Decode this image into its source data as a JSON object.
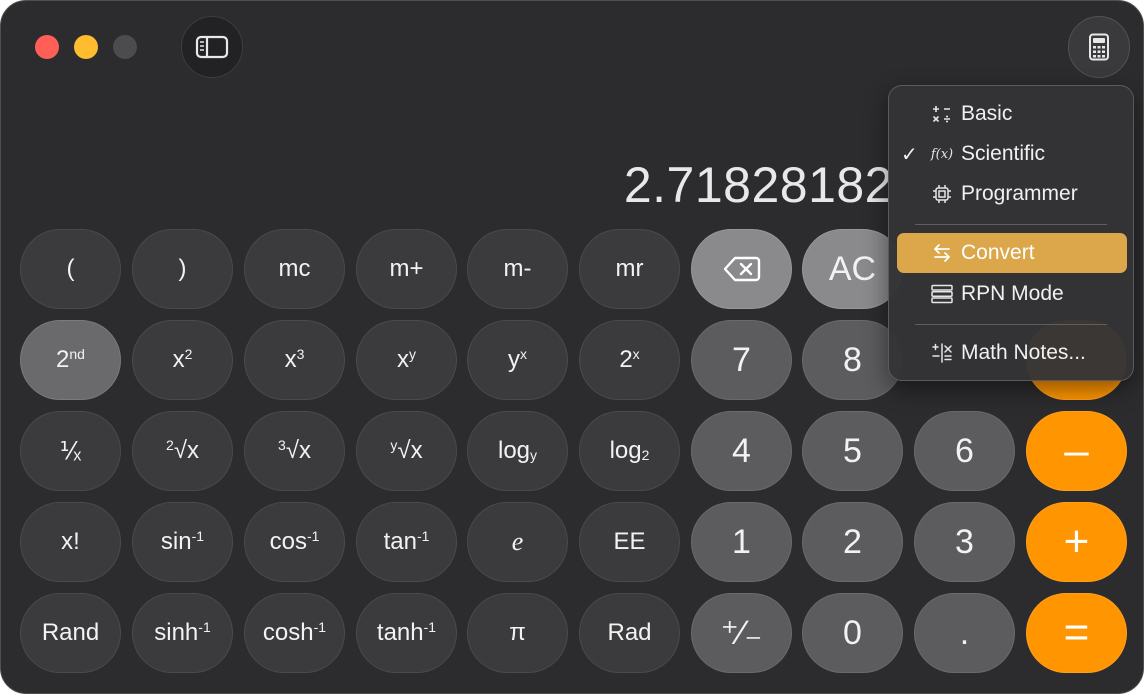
{
  "window": {
    "traffic_lights": [
      "#ff5f57",
      "#febc2e",
      "#4c4c4e"
    ]
  },
  "toolbar": {
    "sidebar_icon": "sidebar-icon",
    "mode_icon": "calculator-icon"
  },
  "display": {
    "value": "2.71828182"
  },
  "keypad": {
    "row1": [
      "(",
      ")",
      "mc",
      "m+",
      "m-",
      "mr",
      "⌫",
      "AC"
    ],
    "row2": {
      "second": "2",
      "second_sup": "nd",
      "x2": "x",
      "x2_sup": "2",
      "x3": "x",
      "x3_sup": "3",
      "xy": "x",
      "xy_sup": "y",
      "yx": "y",
      "yx_sup": "x",
      "twox": "2",
      "twox_sup": "x",
      "seven": "7",
      "eight": "8"
    },
    "row3": {
      "recip": "⅟ₓ",
      "sqrt2_pre": "2",
      "sqrt2": "√x",
      "sqrt3_pre": "3",
      "sqrt3": "√x",
      "sqrty_pre": "y",
      "sqrty": "√x",
      "logy": "log",
      "logy_sub": "y",
      "log2": "log",
      "log2_sub": "2",
      "four": "4",
      "five": "5",
      "six": "6",
      "minus": "–"
    },
    "row4": {
      "fact": "x!",
      "asin": "sin",
      "asin_sup": "-1",
      "acos": "cos",
      "acos_sup": "-1",
      "atan": "tan",
      "atan_sup": "-1",
      "e": "e",
      "ee": "EE",
      "one": "1",
      "two": "2",
      "three": "3",
      "plus": "+"
    },
    "row5": {
      "rand": "Rand",
      "asinh": "sinh",
      "asinh_sup": "-1",
      "acosh": "cosh",
      "acosh_sup": "-1",
      "atanh": "tanh",
      "atanh_sup": "-1",
      "pi": "π",
      "rad": "Rad",
      "plusminus": "⁺∕₋",
      "zero": "0",
      "dot": ".",
      "equals": "="
    }
  },
  "menu": {
    "items": [
      {
        "label": "Basic",
        "checked": false,
        "icon": "basic-ops-icon"
      },
      {
        "label": "Scientific",
        "checked": true,
        "check": "✓",
        "icon_text": "f(x)"
      },
      {
        "label": "Programmer",
        "checked": false,
        "icon": "chip-icon"
      },
      {
        "label": "Convert",
        "checked": false,
        "icon": "convert-arrows-icon",
        "highlighted": true
      },
      {
        "label": "RPN Mode",
        "checked": false,
        "icon": "stack-icon"
      },
      {
        "label": "Math Notes...",
        "checked": false,
        "icon": "math-notes-icon"
      }
    ]
  },
  "colors": {
    "accent_orange": "#ff9500",
    "menu_highlight": "#dca64a",
    "window_bg": "#2c2c2e"
  }
}
